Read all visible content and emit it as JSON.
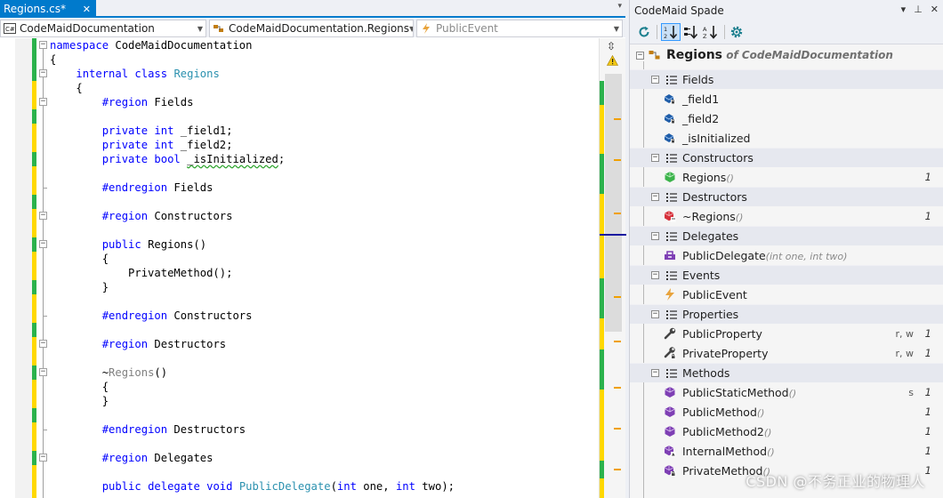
{
  "editor": {
    "tab": {
      "label": "Regions.cs*",
      "close": "✕"
    },
    "overflow": "▾",
    "nav": {
      "project": "CodeMaidDocumentation",
      "type": "CodeMaidDocumentation.Regions",
      "member": "PublicEvent"
    },
    "lines": [
      [
        [
          "kw",
          "namespace"
        ],
        [
          "txt",
          " CodeMaidDocumentation"
        ]
      ],
      [
        [
          "txt",
          "{"
        ]
      ],
      [
        [
          "txt",
          "    "
        ],
        [
          "kw",
          "internal"
        ],
        [
          "txt",
          " "
        ],
        [
          "kw",
          "class"
        ],
        [
          "txt",
          " "
        ],
        [
          "tp",
          "Regions"
        ]
      ],
      [
        [
          "txt",
          "    {"
        ]
      ],
      [
        [
          "txt",
          "        "
        ],
        [
          "kw",
          "#region"
        ],
        [
          "txt",
          " Fields"
        ]
      ],
      [],
      [
        [
          "txt",
          "        "
        ],
        [
          "kw",
          "private"
        ],
        [
          "txt",
          " "
        ],
        [
          "kw",
          "int"
        ],
        [
          "txt",
          " _field1;"
        ]
      ],
      [
        [
          "txt",
          "        "
        ],
        [
          "kw",
          "private"
        ],
        [
          "txt",
          " "
        ],
        [
          "kw",
          "int"
        ],
        [
          "txt",
          " _field2;"
        ]
      ],
      [
        [
          "txt",
          "        "
        ],
        [
          "kw",
          "private"
        ],
        [
          "txt",
          " "
        ],
        [
          "kw",
          "bool"
        ],
        [
          "txt",
          " "
        ],
        [
          "sq",
          "_isInitialized"
        ],
        [
          "txt",
          ";"
        ]
      ],
      [],
      [
        [
          "txt",
          "        "
        ],
        [
          "kw",
          "#endregion"
        ],
        [
          "txt",
          " Fields"
        ]
      ],
      [],
      [
        [
          "txt",
          "        "
        ],
        [
          "kw",
          "#region"
        ],
        [
          "txt",
          " Constructors"
        ]
      ],
      [],
      [
        [
          "txt",
          "        "
        ],
        [
          "kw",
          "public"
        ],
        [
          "txt",
          " Regions()"
        ]
      ],
      [
        [
          "txt",
          "        {"
        ]
      ],
      [
        [
          "txt",
          "            PrivateMethod();"
        ]
      ],
      [
        [
          "txt",
          "        }"
        ]
      ],
      [],
      [
        [
          "txt",
          "        "
        ],
        [
          "kw",
          "#endregion"
        ],
        [
          "txt",
          " Constructors"
        ]
      ],
      [],
      [
        [
          "txt",
          "        "
        ],
        [
          "kw",
          "#region"
        ],
        [
          "txt",
          " Destructors"
        ]
      ],
      [],
      [
        [
          "txt",
          "        ~"
        ],
        [
          "gr",
          "Regions"
        ],
        [
          "txt",
          "()"
        ]
      ],
      [
        [
          "txt",
          "        {"
        ]
      ],
      [
        [
          "txt",
          "        }"
        ]
      ],
      [],
      [
        [
          "txt",
          "        "
        ],
        [
          "kw",
          "#endregion"
        ],
        [
          "txt",
          " Destructors"
        ]
      ],
      [],
      [
        [
          "txt",
          "        "
        ],
        [
          "kw",
          "#region"
        ],
        [
          "txt",
          " Delegates"
        ]
      ],
      [],
      [
        [
          "txt",
          "        "
        ],
        [
          "kw",
          "public"
        ],
        [
          "txt",
          " "
        ],
        [
          "kw",
          "delegate"
        ],
        [
          "txt",
          " "
        ],
        [
          "kw",
          "void"
        ],
        [
          "txt",
          " "
        ],
        [
          "tp",
          "PublicDelegate"
        ],
        [
          "txt",
          "("
        ],
        [
          "kw",
          "int"
        ],
        [
          "txt",
          " one, "
        ],
        [
          "kw",
          "int"
        ],
        [
          "txt",
          " two);"
        ]
      ]
    ]
  },
  "spade": {
    "title": "CodeMaid Spade",
    "controls": {
      "dropdown": "▾",
      "pin": "⊥",
      "close": "✕"
    },
    "root": {
      "name": "Regions",
      "of": " of CodeMaidDocumentation"
    },
    "rows": [
      {
        "kind": "region",
        "label": "Fields"
      },
      {
        "kind": "field",
        "label": "_field1",
        "sig": "",
        "flags": "",
        "count": ""
      },
      {
        "kind": "field",
        "label": "_field2",
        "sig": "",
        "flags": "",
        "count": ""
      },
      {
        "kind": "field",
        "label": "_isInitialized",
        "sig": "",
        "flags": "",
        "count": ""
      },
      {
        "kind": "region",
        "label": "Constructors"
      },
      {
        "kind": "ctor",
        "label": "Regions",
        "sig": "()",
        "flags": "",
        "count": "1"
      },
      {
        "kind": "region",
        "label": "Destructors"
      },
      {
        "kind": "dtor",
        "label": "~Regions",
        "sig": "()",
        "flags": "",
        "count": "1"
      },
      {
        "kind": "region",
        "label": "Delegates"
      },
      {
        "kind": "delegate",
        "label": "PublicDelegate",
        "sig": "(int one, int two)",
        "flags": "",
        "count": ""
      },
      {
        "kind": "region",
        "label": "Events"
      },
      {
        "kind": "event",
        "label": "PublicEvent",
        "sig": "",
        "flags": "",
        "count": ""
      },
      {
        "kind": "region",
        "label": "Properties"
      },
      {
        "kind": "property",
        "label": "PublicProperty",
        "sig": "",
        "flags": "r, w",
        "count": "1"
      },
      {
        "kind": "property-private",
        "label": "PrivateProperty",
        "sig": "",
        "flags": "r, w",
        "count": "1"
      },
      {
        "kind": "region",
        "label": "Methods"
      },
      {
        "kind": "method",
        "label": "PublicStaticMethod",
        "sig": "()",
        "flags": "s",
        "count": "1"
      },
      {
        "kind": "method",
        "label": "PublicMethod",
        "sig": "()",
        "flags": "",
        "count": "1"
      },
      {
        "kind": "method",
        "label": "PublicMethod2",
        "sig": "()",
        "flags": "",
        "count": "1"
      },
      {
        "kind": "method-internal",
        "label": "InternalMethod",
        "sig": "()",
        "flags": "",
        "count": "1"
      },
      {
        "kind": "method-private",
        "label": "PrivateMethod",
        "sig": "()",
        "flags": "",
        "count": "1"
      }
    ]
  },
  "watermark": "CSDN @不务正业的物理人",
  "colors": {
    "accent": "#007acc",
    "keyword": "#0000ff",
    "type": "#2b91af",
    "change_green": "#2bb24c",
    "change_yellow": "#ffd800",
    "method_purple": "#7e3fb4"
  }
}
